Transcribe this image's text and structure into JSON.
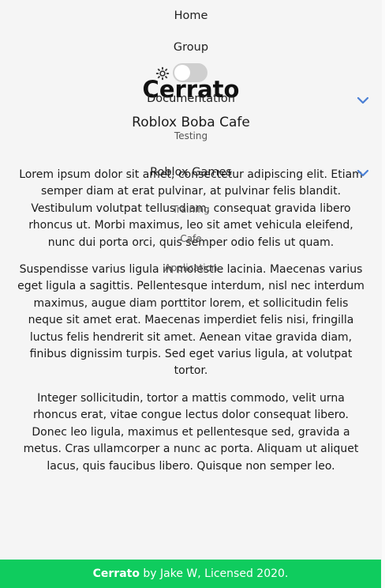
{
  "nav": {
    "home": "Home",
    "group": "Group",
    "documentation": "Documentation",
    "documentation_sub": [
      "Testing"
    ],
    "roblox_games": "Roblox Games",
    "roblox_games_sub": [
      "Training",
      "Cafe",
      "Application"
    ]
  },
  "icons": {
    "theme": "sun-icon",
    "expand": "chevron-down-icon"
  },
  "site": {
    "title": "Cerrato"
  },
  "page": {
    "title": "Roblox Boba Cafe",
    "paragraphs": [
      "Lorem ipsum dolor sit amet, consectetur adipiscing elit. Etiam semper diam at erat pulvinar, at pulvinar felis blandit. Vestibulum volutpat tellus diam, consequat gravida libero rhoncus ut. Morbi maximus, leo sit amet vehicula eleifend, nunc dui porta orci, quis semper odio felis ut quam.",
      "Suspendisse varius ligula in molestie lacinia. Maecenas varius eget ligula a sagittis. Pellentesque interdum, nisl nec interdum maximus, augue diam porttitor lorem, et sollicitudin felis neque sit amet erat. Maecenas imperdiet felis nisi, fringilla luctus felis hendrerit sit amet. Aenean vitae gravida diam, finibus dignissim turpis. Sed eget varius ligula, at volutpat tortor.",
      "Integer sollicitudin, tortor a mattis commodo, velit urna rhoncus erat, vitae congue lectus dolor consequat libero. Donec leo ligula, maximus et pellentesque sed, gravida a metus. Cras ullamcorper a nunc ac porta. Aliquam ut aliquet lacus, quis faucibus libero. Quisque non semper leo."
    ]
  },
  "footer": {
    "brand": "Cerrato",
    "text": " by Jake W, Licensed 2020."
  },
  "colors": {
    "footer_bg": "#0fcc5e",
    "chevron": "#4a7fd4",
    "toggle_track": "#cfcfcf"
  }
}
